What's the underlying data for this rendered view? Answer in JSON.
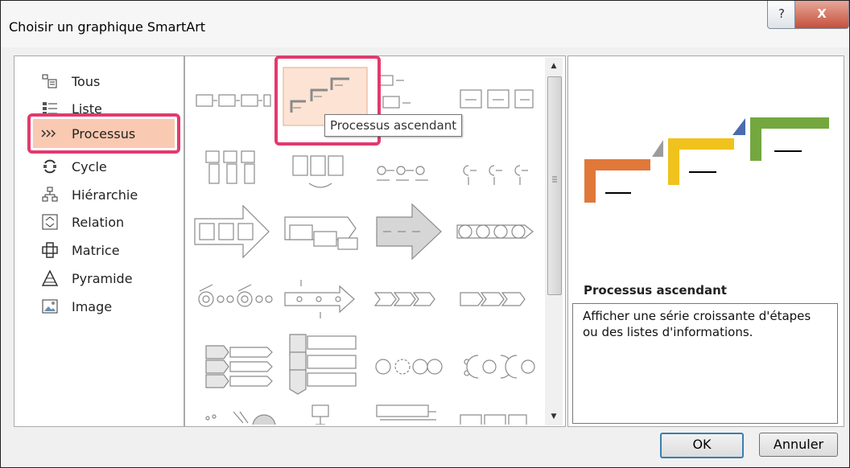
{
  "window": {
    "title": "Choisir un graphique SmartArt",
    "help_label": "?",
    "close_label": "X"
  },
  "categories": [
    {
      "label": "Tous",
      "icon": "list-all-icon"
    },
    {
      "label": "Liste",
      "icon": "list-icon"
    },
    {
      "label": "Processus",
      "icon": "process-icon",
      "selected": true
    },
    {
      "label": "Cycle",
      "icon": "cycle-icon"
    },
    {
      "label": "Hiérarchie",
      "icon": "hierarchy-icon"
    },
    {
      "label": "Relation",
      "icon": "relation-icon"
    },
    {
      "label": "Matrice",
      "icon": "matrix-icon"
    },
    {
      "label": "Pyramide",
      "icon": "pyramid-icon"
    },
    {
      "label": "Image",
      "icon": "image-icon"
    }
  ],
  "gallery": {
    "selected": "Processus ascendant",
    "tooltip": "Processus ascendant",
    "items": [
      "basic-process",
      "step-up-process",
      "accent-process",
      "alternating-flow",
      "picture-accent-process",
      "repeating-bending-process",
      "circle-accent-timeline",
      "basic-timeline",
      "process-arrows",
      "continuous-block-process",
      "upward-arrow",
      "circle-arrow-process",
      "process-chevron",
      "pie-process",
      "basic-chevron-process",
      "closed-chevron-process",
      "vertical-chevron-list",
      "segmented-process",
      "circle-process",
      "equation",
      "funnel",
      "bending-picture-process",
      "phased-process",
      "tab-list"
    ]
  },
  "preview": {
    "title": "Processus ascendant",
    "description": "Afficher une série croissante d'étapes ou des listes d'informations.",
    "colors": {
      "orange": "#e0783a",
      "yellow": "#f0c21c",
      "green": "#74a83e",
      "gray": "#9c9c9c",
      "blue": "#4a6bb0"
    }
  },
  "buttons": {
    "ok": "OK",
    "cancel": "Annuler"
  },
  "highlight_color": "#e23a6e",
  "selection_color": "#f9c9b1"
}
